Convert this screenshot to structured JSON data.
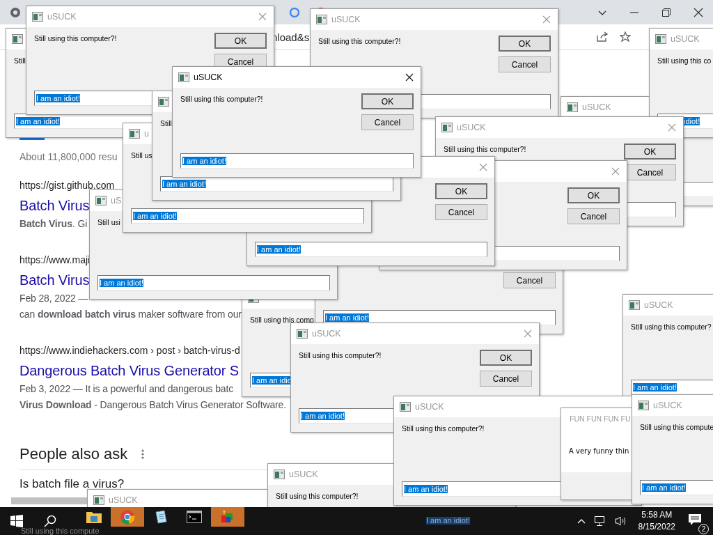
{
  "browser": {
    "address_fragment": "nload&s",
    "results_count": "About 11,800,000 resu",
    "results": [
      {
        "url": "https://gist.github.com",
        "title": "Batch Virus",
        "snippet": [
          "**Batch Virus**. Gi"
        ]
      },
      {
        "url": "https://www.maji",
        "title": "Batch Virus",
        "snippet": [
          "Feb 28, 2022 —",
          "can **download batch virus** maker software from our"
        ]
      },
      {
        "url": "https://www.indiehackers.com › post › batch-virus-d",
        "title": "Dangerous Batch Virus Generator S",
        "snippet": [
          "Feb 3, 2022 — It is a powerful and dangerous batc",
          "**Virus Download** - Dangerous Batch Virus Generator Software."
        ]
      }
    ],
    "people_also_ask": {
      "heading": "People also ask",
      "questions": [
        "Is batch file a virus?"
      ]
    }
  },
  "windows": [
    {
      "kind": "dialog",
      "message": "Still",
      "input": "I am an idiot!",
      "input_selected": true
    },
    {
      "kind": "dialog",
      "active": false,
      "close": true,
      "title": "uSUCK",
      "message": "Still using this computer?!",
      "ok": "OK",
      "cancel": "Cancel",
      "input": "I am an idiot!",
      "input_selected": true
    },
    {
      "kind": "dialog",
      "active": false,
      "title": "uSUCK"
    },
    {
      "kind": "dialog",
      "active": false,
      "title": "uSUCK",
      "message": "Still using this co",
      "input": "idiot!",
      "input_selected": true
    },
    {
      "kind": "dialog",
      "active": false,
      "close": true,
      "title": "uSUCK",
      "message": "Still using this computer?!",
      "ok": "OK",
      "cancel": "Cancel"
    },
    {
      "kind": "dialog",
      "message": "Still using this comp",
      "input": "I am an idio",
      "input_selected": true
    },
    {
      "kind": "dialog",
      "cancel": "Cancel",
      "input": "I am an idiot!",
      "input_selected": true
    },
    {
      "kind": "dialog",
      "active": false,
      "close": true,
      "title": "uSUCK",
      "message": "Still using this computer?!",
      "ok": "OK",
      "cancel": "Cancel"
    },
    {
      "kind": "dialog",
      "close": true,
      "ok": "OK",
      "cancel": "Cancel"
    },
    {
      "kind": "dialog",
      "active": false,
      "title": "uS",
      "message": "Still usi",
      "input": "I am an idiot!",
      "input_selected": true
    },
    {
      "kind": "dialog",
      "close": true,
      "ok": "OK",
      "cancel": "Cancel",
      "input": "I am an idiot!",
      "input_selected": true
    },
    {
      "kind": "dialog",
      "active": false,
      "title": "u",
      "message": "Still us",
      "input": "I am an idiot!",
      "input_selected": true
    },
    {
      "kind": "dialog",
      "message": "Still",
      "input": "I am an idiot!",
      "input_selected": true
    },
    {
      "kind": "dialog",
      "active": true,
      "close": true,
      "title": "uSUCK",
      "message": "Still using this computer?!",
      "ok": "OK",
      "cancel": "Cancel",
      "input": "I am an idiot!",
      "input_selected": true
    },
    {
      "kind": "dialog",
      "active": false,
      "close": true,
      "title": "uSUCK",
      "message": "Still using this computer?!",
      "ok": "OK",
      "cancel": "Cancel",
      "input": "I am an idiot!",
      "input_selected": true
    },
    {
      "kind": "dialog",
      "active": false,
      "title": "uSUCK",
      "message": "Still using this computer?",
      "input": "I am an idiot!",
      "input_selected": true
    },
    {
      "kind": "dialog",
      "active": false,
      "title": "uSUCK"
    },
    {
      "kind": "dialog",
      "active": false,
      "title": "uSUCK",
      "message": "Still using this computer?!"
    },
    {
      "kind": "dialog",
      "active": false,
      "title": "uSUCK",
      "message": "Still using this computer?!",
      "input": "I am an idiot!",
      "input_selected": true
    },
    {
      "kind": "message_box",
      "active": false,
      "title": "FUN FUN FUN FU",
      "message": "A very funny thin"
    },
    {
      "kind": "dialog",
      "active": false,
      "title": "uSUCK",
      "message": "Still using this compute",
      "input": "I am an idiot!",
      "input_selected": true
    }
  ],
  "taskbar": {
    "apps": [
      {
        "kind": "folder",
        "flashing": false
      },
      {
        "kind": "browser",
        "flashing": true
      },
      {
        "kind": "notepad",
        "flashing": false
      },
      {
        "kind": "console",
        "flashing": false
      },
      {
        "kind": "blocks",
        "flashing": true
      }
    ],
    "ghost_texts": [
      "Still using this compute",
      "I am an idiot!"
    ],
    "time": "5:58 AM",
    "date": "8/15/2022",
    "notifications": "2"
  }
}
